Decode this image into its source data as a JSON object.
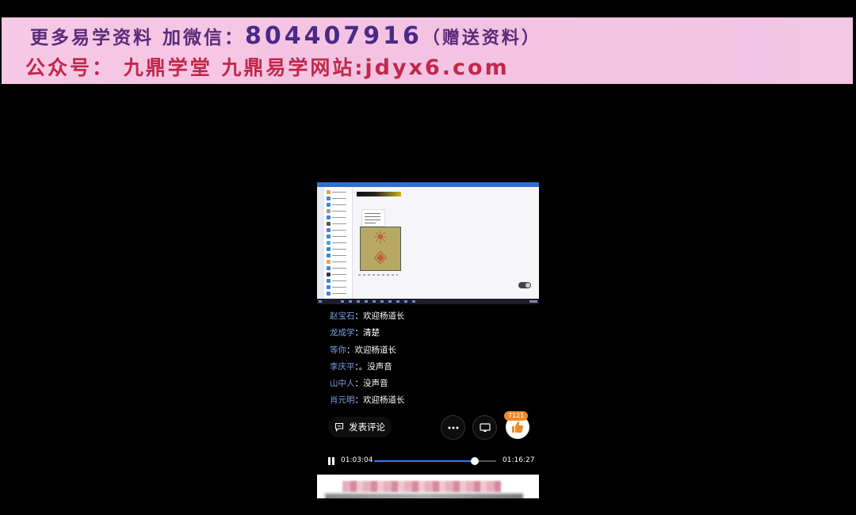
{
  "banner": {
    "line1_prefix": "更多易学资料 加微信：",
    "line1_number": "804407916",
    "line1_suffix": "（赠送资料）",
    "line2_prefix": "公众号： 九鼎学堂 九鼎易学网站:",
    "line2_site": "jdyx6.com"
  },
  "comments": [
    {
      "user": "赵宝石",
      "text": "欢迎杨道长"
    },
    {
      "user": "龙成学",
      "text": "清楚"
    },
    {
      "user": "等你",
      "text": "欢迎杨道长"
    },
    {
      "user": "李庆平",
      "text": "。没声音"
    },
    {
      "user": "山中人",
      "text": "没声音"
    },
    {
      "user": "肖元明",
      "text": "欢迎杨道长"
    }
  ],
  "separator": "：",
  "actions": {
    "comment_label": "发表评论",
    "like_count": "7121"
  },
  "player": {
    "current_time": "01:03:04",
    "total_time": "01:16:27",
    "progress": 0.8248
  },
  "icons": {
    "comment": "comment-icon",
    "more": "more-dots-icon",
    "cast": "cast-screen-icon",
    "like": "thumbs-up-icon",
    "pause": "pause-icon"
  },
  "colors": {
    "username": "#7a9fe0",
    "progress": "#2f7df6",
    "like": "#f08a25"
  }
}
